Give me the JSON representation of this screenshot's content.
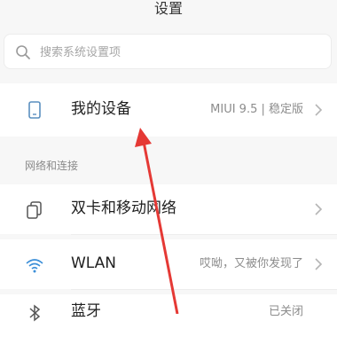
{
  "header": {
    "title": "设置"
  },
  "search": {
    "placeholder": "搜索系统设置项"
  },
  "device": {
    "label": "我的设备",
    "value": "MIUI 9.5 | 稳定版"
  },
  "section": {
    "title": "网络和连接"
  },
  "rows": [
    {
      "label": "双卡和移动网络",
      "value": ""
    },
    {
      "label": "WLAN",
      "value": "哎呦，又被你发现了"
    },
    {
      "label": "蓝牙",
      "value": "已关闭"
    }
  ],
  "colors": {
    "accent": "#e53935",
    "background": "#f7f7f7",
    "muted": "#8c8c8c"
  }
}
